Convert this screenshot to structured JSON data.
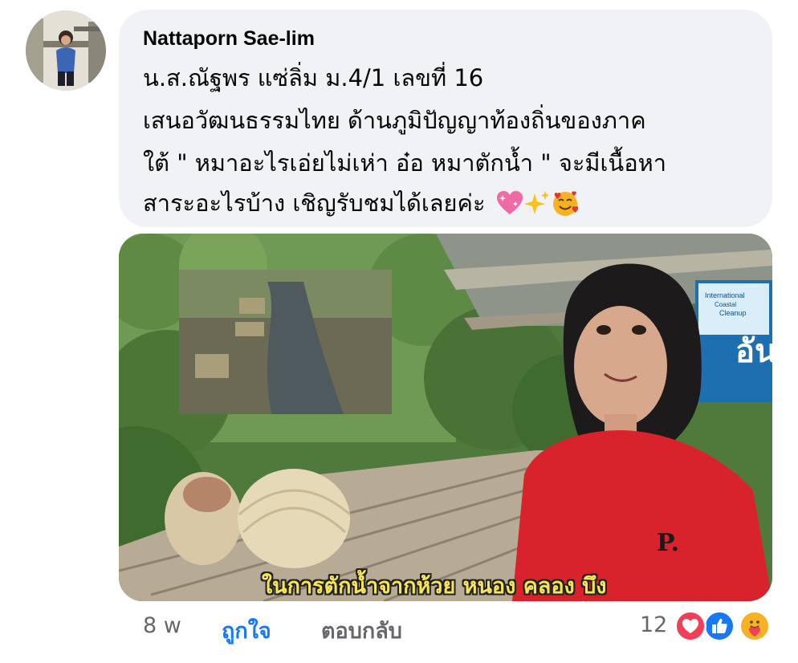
{
  "comment": {
    "author": "Nattaporn Sae-lim",
    "lines": [
      "น.ส.ณัฐพร แซ่ลิ่ม ม.4/1 เลขที่ 16",
      "เสนอวัฒนธรรมไทย ด้านภูมิปัญญาท้องถิ่นของภาค",
      "ใต้ \" หมาอะไรเอ่ยไม่เห่า อ๋อ  หมาตักน้ำ \" จะมีเนื้อหา",
      "สาระอะไรบ้าง เชิญรับชมได้เลยค่ะ"
    ],
    "emojis": [
      "sparkling-heart",
      "sparkles",
      "smiling-face-with-hearts"
    ]
  },
  "media": {
    "subtitle": "ในการตักน้ำจากห้วย หนอง คลอง บึง",
    "sign_text": [
      "International",
      "Coastal",
      "Cleanup",
      "อัน"
    ],
    "shirt_letter": "P."
  },
  "footer": {
    "time": "8 w",
    "like_label": "ถูกใจ",
    "reply_label": "ตอบกลับ",
    "reaction_count": "12",
    "reactions": [
      "love",
      "like",
      "care"
    ]
  },
  "colors": {
    "bubble": "#f0f2f5",
    "like_active": "#1877f2",
    "meta_text": "#65676b",
    "subtitle_yellow": "#f6e45a",
    "love_red": "#f33e58",
    "care_yellow": "#f7b125"
  }
}
